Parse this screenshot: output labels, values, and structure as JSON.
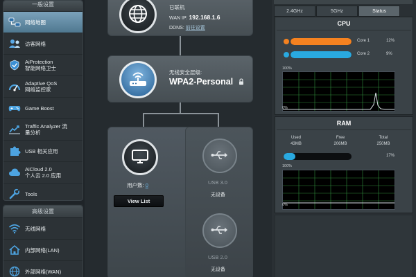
{
  "sidebar": {
    "general_header": "一般设置",
    "general_items": [
      {
        "label": "网络地图",
        "icon": "network-map-icon",
        "active": true
      },
      {
        "label": "访客网络",
        "icon": "guest-network-icon",
        "active": false
      },
      {
        "label": "AiProtection\n智能网络卫士",
        "icon": "aiprotection-icon",
        "active": false
      },
      {
        "label": "Adaptive QoS\n网络监控家",
        "icon": "qos-icon",
        "active": false
      },
      {
        "label": "Game Boost",
        "icon": "gamepad-icon",
        "active": false
      },
      {
        "label": "Traffic Analyzer 流\n量分析",
        "icon": "traffic-analyzer-icon",
        "active": false
      },
      {
        "label": "USB 相关应用",
        "icon": "usb-puzzle-icon",
        "active": false
      },
      {
        "label": "AiCloud 2.0\n个人云 2.0 应用",
        "icon": "aicloud-icon",
        "active": false
      },
      {
        "label": "Tools",
        "icon": "tools-icon",
        "active": false
      }
    ],
    "advanced_header": "高级设置",
    "advanced_items": [
      {
        "label": "无线网络",
        "icon": "wifi-icon"
      },
      {
        "label": "内部网络(LAN)",
        "icon": "home-icon"
      },
      {
        "label": "外部网络(WAN)",
        "icon": "globe-icon"
      }
    ]
  },
  "map": {
    "internet_status": "已联机",
    "wan_ip_label": "WAN IP:",
    "wan_ip_value": "192.168.1.6",
    "ddns_label": "DDNS:",
    "ddns_link": "前往设置",
    "security_label": "无线安全层级:",
    "security_value": "WPA2-Personal",
    "clients_label": "用户数:",
    "clients_count": "0",
    "view_list_button": "View List",
    "usb1_label": "USB 3.0",
    "usb1_status": "无设备",
    "usb2_label": "USB 2.0",
    "usb2_status": "无设备"
  },
  "status_panel": {
    "tabs": [
      {
        "label": "2.4GHz",
        "active": false
      },
      {
        "label": "5GHz",
        "active": false
      },
      {
        "label": "Status",
        "active": true
      }
    ],
    "cpu_title": "CPU",
    "cores": [
      {
        "name": "Core 1",
        "percent": "12%",
        "fill": 1.0,
        "color": "#f58220"
      },
      {
        "name": "Core 2",
        "percent": "9%",
        "fill": 1.0,
        "color": "#29a9e0"
      }
    ],
    "graph_axis_top": "100%",
    "graph_axis_bottom": "0%",
    "ram_title": "RAM",
    "ram_used_label": "Used",
    "ram_used_value": "43MB",
    "ram_free_label": "Free",
    "ram_free_value": "206MB",
    "ram_total_label": "Total",
    "ram_total_value": "250MB",
    "ram_percent": "17%",
    "ram_fill": 0.17,
    "colors": {
      "active_nav": "#5f88a2",
      "cpu_core1": "#f58220",
      "cpu_core2": "#29a9e0",
      "ram_bar": "#29a9e0",
      "graph_line": "#d9e1e6",
      "link_text": "#a7c7dc",
      "client_count": "#6cb6e6"
    }
  }
}
